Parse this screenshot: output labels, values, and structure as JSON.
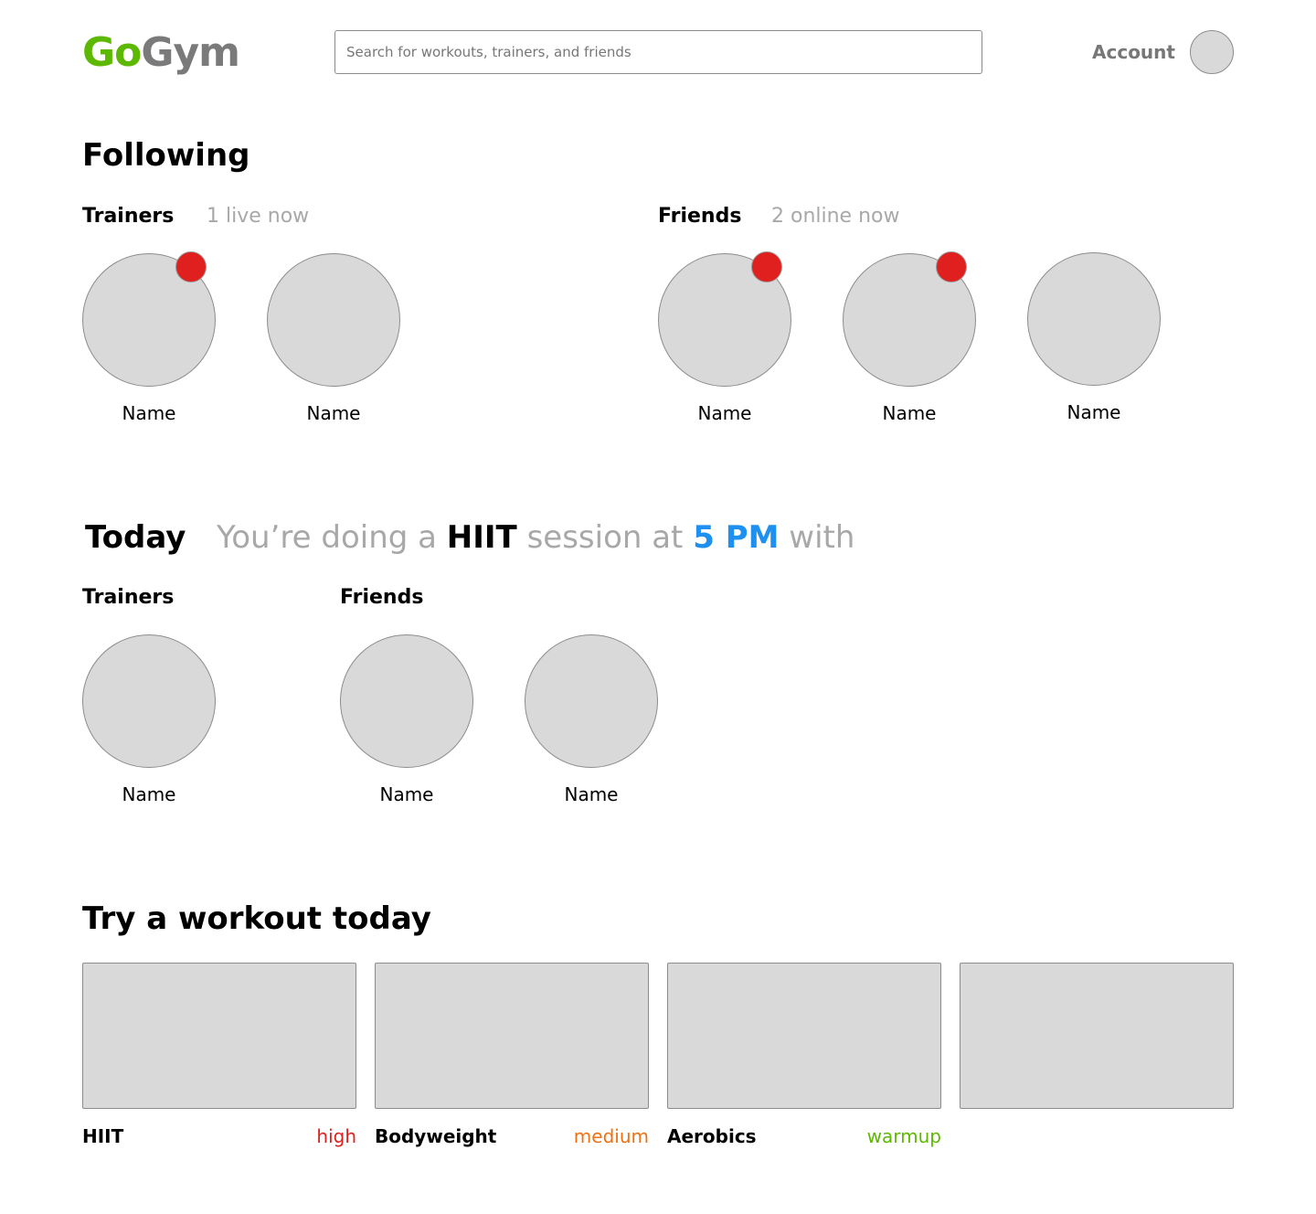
{
  "header": {
    "logo_go": "Go",
    "logo_gym": "Gym",
    "search_placeholder": "Search for workouts, trainers, and friends",
    "account_label": "Account"
  },
  "following": {
    "title": "Following",
    "trainers": {
      "label": "Trainers",
      "status": "1 live now",
      "people": [
        {
          "name": "Name",
          "live": true
        },
        {
          "name": "Name",
          "live": false
        }
      ]
    },
    "friends": {
      "label": "Friends",
      "status": "2 online now",
      "people": [
        {
          "name": "Name",
          "online": true
        },
        {
          "name": "Name",
          "online": true
        },
        {
          "name": "Name",
          "online": false
        }
      ]
    }
  },
  "today": {
    "title": "Today",
    "sentence_pre": "You’re doing a",
    "session_type": "HIIT",
    "sentence_mid": "session at",
    "time": "5 PM",
    "sentence_post": "with",
    "trainers": {
      "label": "Trainers",
      "people": [
        {
          "name": "Name"
        }
      ]
    },
    "friends": {
      "label": "Friends",
      "people": [
        {
          "name": "Name"
        },
        {
          "name": "Name"
        }
      ]
    }
  },
  "workouts": {
    "title": "Try a workout today",
    "items": [
      {
        "name": "HIIT",
        "level": "high",
        "level_color": "#e0201f"
      },
      {
        "name": "Bodyweight",
        "level": "medium",
        "level_color": "#f07010"
      },
      {
        "name": "Aerobics",
        "level": "warmup",
        "level_color": "#5cb800"
      },
      {
        "name": "",
        "level": "",
        "level_color": ""
      }
    ]
  },
  "colors": {
    "brand_green": "#5cb800",
    "brand_gray": "#7a7a7a",
    "accent_blue": "#1e90f0",
    "live_red": "#e0201f",
    "placeholder_fill": "#d9d9d9"
  }
}
